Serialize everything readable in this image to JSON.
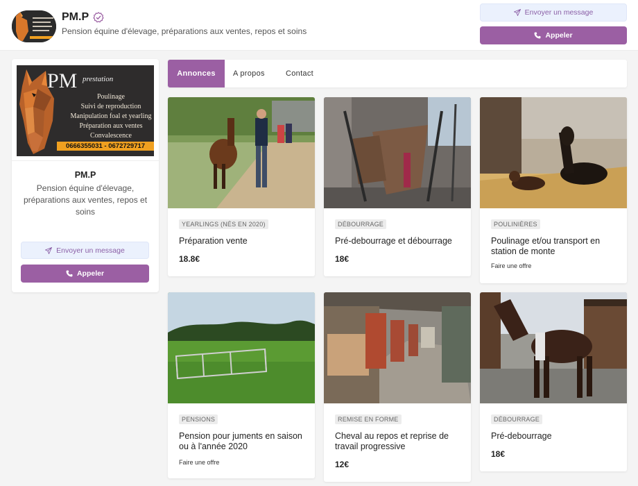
{
  "header": {
    "brand": "PM.P",
    "tagline": "Pension équine d'élevage, préparations aux ventes, repos et soins",
    "message_label": "Envoyer un message",
    "call_label": "Appeler"
  },
  "sidebar": {
    "logo": {
      "pm": "PM",
      "prestation": "prestation",
      "lines": [
        "Poulinage",
        "Suivi de reproduction",
        "Manipulation foal et yearling",
        "Préparation aux ventes",
        "Convalescence"
      ],
      "phone": "0666355031 - 0672729717"
    },
    "name": "PM.P",
    "description": "Pension équine d'élevage, préparations aux ventes, repos et soins",
    "message_label": "Envoyer un message",
    "call_label": "Appeler"
  },
  "tabs": [
    {
      "label": "Annonces",
      "active": true
    },
    {
      "label": "A propos",
      "active": false
    },
    {
      "label": "Contact",
      "active": false
    }
  ],
  "listings": [
    {
      "tag": "YEARLINGS (NÉS EN 2020)",
      "title": "Préparation vente",
      "price": "18.8€",
      "offer": ""
    },
    {
      "tag": "DÉBOURRAGE",
      "title": "Pré-debourrage et débourrage",
      "price": "18€",
      "offer": ""
    },
    {
      "tag": "POULINIÈRES",
      "title": "Poulinage et/ou transport en station de monte",
      "price": "",
      "offer": "Faire une offre"
    },
    {
      "tag": "PENSIONS",
      "title": "Pension pour juments en saison ou à l'année 2020",
      "price": "",
      "offer": "Faire une offre"
    },
    {
      "tag": "REMISE EN FORME",
      "title": "Cheval au repos et reprise de travail progressive",
      "price": "12€",
      "offer": ""
    },
    {
      "tag": "DÉBOURRAGE",
      "title": "Pré-debourrage",
      "price": "18€",
      "offer": ""
    }
  ],
  "colors": {
    "accent": "#9b5fa3",
    "message_bg": "#ebf1fd",
    "logo_orange": "#f0a020"
  }
}
